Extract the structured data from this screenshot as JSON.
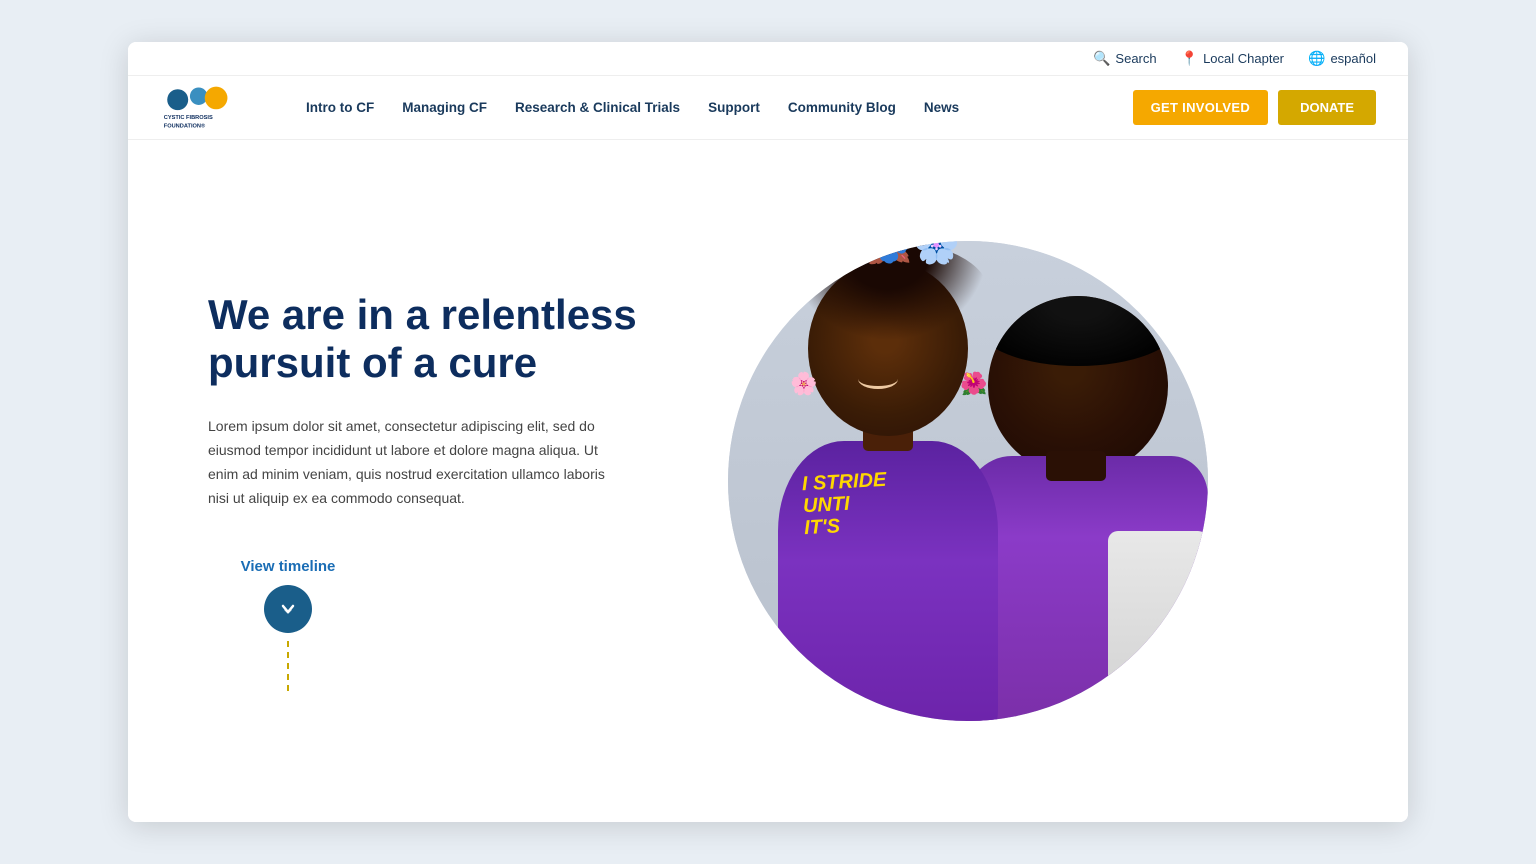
{
  "browser": {
    "background": "#e8eef4"
  },
  "utility_bar": {
    "search_label": "Search",
    "local_chapter_label": "Local Chapter",
    "espanol_label": "español"
  },
  "nav": {
    "logo_text_line1": "CYSTIC FIBROSIS",
    "logo_text_line2": "FOUNDATION",
    "links": [
      {
        "id": "intro-cf",
        "label": "Intro to CF"
      },
      {
        "id": "managing-cf",
        "label": "Managing CF"
      },
      {
        "id": "research-trials",
        "label": "Research & Clinical Trials"
      },
      {
        "id": "support",
        "label": "Support"
      },
      {
        "id": "community-blog",
        "label": "Community Blog"
      },
      {
        "id": "news",
        "label": "News"
      }
    ],
    "get_involved_label": "GET INVOLVED",
    "donate_label": "DONATE"
  },
  "hero": {
    "title": "We are in a relentless pursuit of a cure",
    "body": "Lorem ipsum dolor sit amet, consectetur adipiscing elit, sed do eiusmod tempor incididunt ut labore et dolore magna aliqua. Ut enim ad minim veniam, quis nostrud exercitation ullamco laboris nisi ut aliquip ex ea commodo consequat.",
    "view_timeline_label": "View timeline",
    "shirt_text_line1": "I STRIDE",
    "shirt_text_line2": "UNTI",
    "shirt_text_line3": "IT'S"
  },
  "colors": {
    "navy": "#0d2d5e",
    "blue_accent": "#1a6db5",
    "orange": "#f5a800",
    "gold": "#d4a800",
    "dark_teal": "#1a5e8a",
    "light_bg": "#e8eef4"
  }
}
